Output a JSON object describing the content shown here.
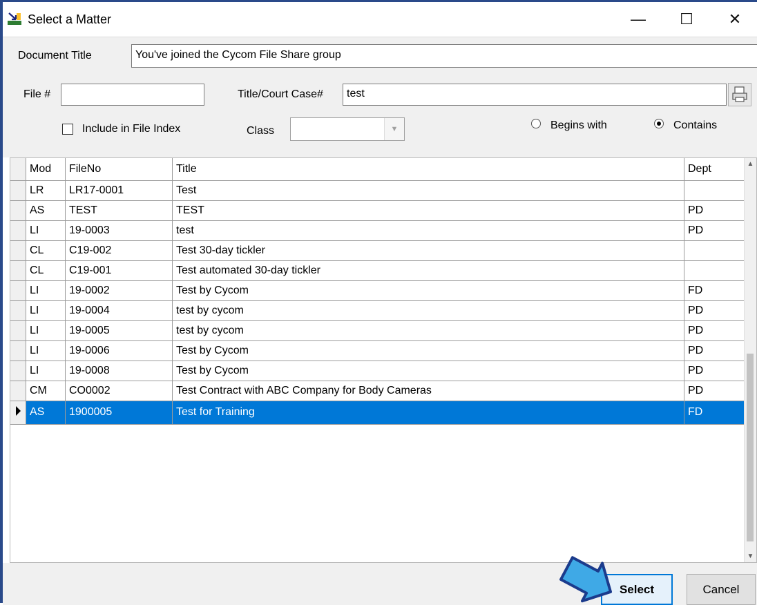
{
  "window": {
    "title": "Select a Matter",
    "controls": {
      "minimize": "—",
      "maximize": "☐",
      "close": "✕"
    }
  },
  "form": {
    "document_title_label": "Document Title",
    "document_title_value": "You've joined the Cycom File Share group",
    "file_no_label": "File #",
    "file_no_value": "",
    "title_case_label": "Title/Court Case#",
    "title_case_value": "test",
    "include_index_label": "Include in File Index",
    "include_index_checked": false,
    "class_label": "Class",
    "class_value": "",
    "search_mode": {
      "begins_with_label": "Begins with",
      "contains_label": "Contains",
      "selected": "Contains"
    }
  },
  "grid": {
    "columns": [
      "Mod",
      "FileNo",
      "Title",
      "Dept"
    ],
    "rows": [
      {
        "mod": "LR",
        "fileno": "LR17-0001",
        "title": "Test",
        "dept": ""
      },
      {
        "mod": "AS",
        "fileno": "TEST",
        "title": "TEST",
        "dept": "PD"
      },
      {
        "mod": "LI",
        "fileno": "19-0003",
        "title": "test",
        "dept": "PD"
      },
      {
        "mod": "CL",
        "fileno": "C19-002",
        "title": "Test 30-day tickler",
        "dept": ""
      },
      {
        "mod": "CL",
        "fileno": "C19-001",
        "title": "Test automated 30-day tickler",
        "dept": ""
      },
      {
        "mod": "LI",
        "fileno": "19-0002",
        "title": "Test by Cycom",
        "dept": "FD"
      },
      {
        "mod": "LI",
        "fileno": "19-0004",
        "title": "test by cycom",
        "dept": "PD"
      },
      {
        "mod": "LI",
        "fileno": "19-0005",
        "title": "test by cycom",
        "dept": "PD"
      },
      {
        "mod": "LI",
        "fileno": "19-0006",
        "title": "Test by Cycom",
        "dept": "PD"
      },
      {
        "mod": "LI",
        "fileno": "19-0008",
        "title": "Test by Cycom",
        "dept": "PD"
      },
      {
        "mod": "CM",
        "fileno": "CO0002",
        "title": "Test Contract with ABC Company for Body Cameras",
        "dept": "PD"
      },
      {
        "mod": "AS",
        "fileno": "1900005",
        "title": "Test for Training",
        "dept": "FD"
      }
    ],
    "selected_row_index": 11
  },
  "buttons": {
    "select_label": "Select",
    "cancel_label": "Cancel"
  },
  "colors": {
    "selection": "#0078d7",
    "arrow_fill": "#3fa9e6",
    "arrow_stroke": "#1b3b8c"
  }
}
